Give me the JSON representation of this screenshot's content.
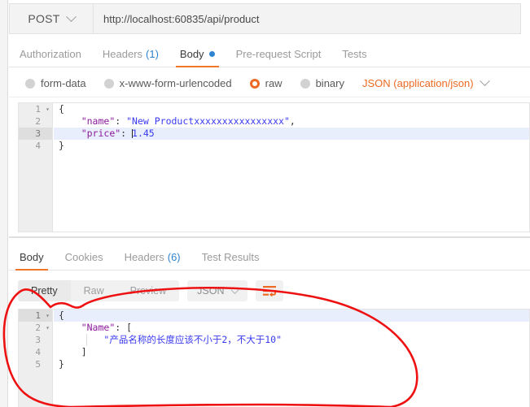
{
  "request": {
    "method": "POST",
    "method_caret_icon": "chevron-down-icon",
    "url": "http://localhost:60835/api/product",
    "tabs": [
      {
        "label": "Authorization",
        "active": false,
        "count": null,
        "dot": false
      },
      {
        "label": "Headers",
        "active": false,
        "count": "(1)",
        "dot": false
      },
      {
        "label": "Body",
        "active": true,
        "count": null,
        "dot": true
      },
      {
        "label": "Pre-request Script",
        "active": false,
        "count": null,
        "dot": false
      },
      {
        "label": "Tests",
        "active": false,
        "count": null,
        "dot": false
      }
    ],
    "body_types": [
      {
        "label": "form-data",
        "selected": false
      },
      {
        "label": "x-www-form-urlencoded",
        "selected": false
      },
      {
        "label": "raw",
        "selected": true
      },
      {
        "label": "binary",
        "selected": false
      }
    ],
    "content_type": "JSON (application/json)",
    "content_type_caret_icon": "chevron-down-icon",
    "editor": {
      "active_line": 3,
      "lines": [
        {
          "n": "1",
          "fold": "▾",
          "text": "{"
        },
        {
          "n": "2",
          "fold": "",
          "text": "    \"name\": \"New Productxxxxxxxxxxxxxxxx\","
        },
        {
          "n": "3",
          "fold": "",
          "text": "    \"price\": 1.45"
        },
        {
          "n": "4",
          "fold": "",
          "text": "}"
        }
      ],
      "key_name": "\"name\"",
      "value_name": "\"New Productxxxxxxxxxxxxxxxx\"",
      "key_price": "\"price\"",
      "value_price": "1.45"
    }
  },
  "response": {
    "tabs": [
      {
        "label": "Body",
        "active": true,
        "count": null
      },
      {
        "label": "Cookies",
        "active": false,
        "count": null
      },
      {
        "label": "Headers",
        "active": false,
        "count": "(6)"
      },
      {
        "label": "Test Results",
        "active": false,
        "count": null
      }
    ],
    "view_modes": [
      {
        "label": "Pretty",
        "active": true
      },
      {
        "label": "Raw",
        "active": false
      },
      {
        "label": "Preview",
        "active": false
      }
    ],
    "format": "JSON",
    "format_caret_icon": "chevron-down-icon",
    "wrap_button_icon": "word-wrap-icon",
    "editor": {
      "active_line": 1,
      "lines": [
        {
          "n": "1",
          "fold": "▾",
          "text": "{"
        },
        {
          "n": "2",
          "fold": "▾",
          "text": "    \"Name\": ["
        },
        {
          "n": "3",
          "fold": "",
          "text": "        \"产品名称的长度应该不小于2，不大于10\""
        },
        {
          "n": "4",
          "fold": "",
          "text": "    ]"
        },
        {
          "n": "5",
          "fold": "",
          "text": "}"
        }
      ],
      "key_name": "\"Name\"",
      "message": "\"产品名称的长度应该不小于2，不大于10\""
    }
  },
  "annotation": {
    "shape": "hand-drawn-red-ellipse",
    "color": "#ee1111"
  },
  "colors": {
    "accent_orange": "#ec6a23",
    "link_blue": "#2f84d1",
    "active_line": "#e8eefc",
    "gutter": "#eeeeee",
    "annotation_red": "#ee1111"
  }
}
